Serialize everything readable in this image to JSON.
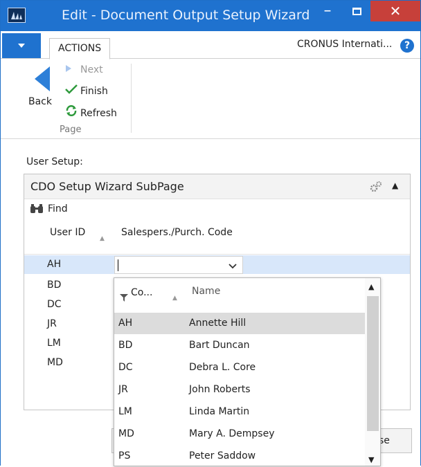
{
  "window": {
    "title": "Edit - Document Output Setup Wizard",
    "minimize": "–",
    "close": "✕"
  },
  "ribbon": {
    "tab": "ACTIONS",
    "company": "CRONUS Internati...",
    "help": "?",
    "back": "Back",
    "next": "Next",
    "finish": "Finish",
    "refresh": "Refresh",
    "group": "Page"
  },
  "content": {
    "section_label": "User Setup:",
    "subpage_title": "CDO Setup Wizard SubPage",
    "find": "Find",
    "col_user_id": "User ID",
    "col_code": "Salespers./Purch. Code",
    "rows": [
      "AH",
      "BD",
      "DC",
      "JR",
      "LM",
      "MD"
    ],
    "bottom_button": "se"
  },
  "dropdown": {
    "col_code": "Co...",
    "col_name": "Name",
    "items": [
      {
        "code": "AH",
        "name": "Annette Hill"
      },
      {
        "code": "BD",
        "name": "Bart Duncan"
      },
      {
        "code": "DC",
        "name": "Debra L. Core"
      },
      {
        "code": "JR",
        "name": "John Roberts"
      },
      {
        "code": "LM",
        "name": "Linda Martin"
      },
      {
        "code": "MD",
        "name": "Mary A. Dempsey"
      },
      {
        "code": "PS",
        "name": "Peter Saddow"
      }
    ]
  },
  "colors": {
    "titlebar": "#1f72cf",
    "close": "#c7403a",
    "selection": "#d8e7fa",
    "accent_green": "#2e9a3c"
  }
}
